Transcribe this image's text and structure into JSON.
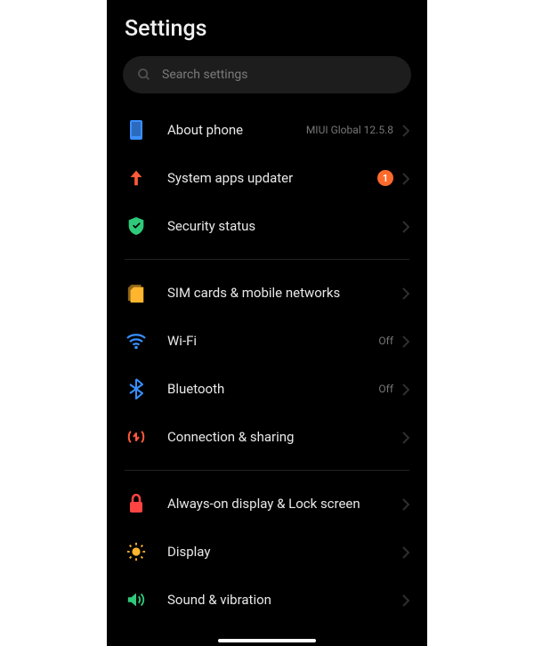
{
  "title": "Settings",
  "search": {
    "placeholder": "Search settings"
  },
  "groups": [
    {
      "items": [
        {
          "key": "about-phone",
          "label": "About phone",
          "status": "MIUI Global 12.5.8",
          "icon": "phone-icon"
        },
        {
          "key": "system-apps-updater",
          "label": "System apps updater",
          "badge": "1",
          "icon": "update-arrow-icon"
        },
        {
          "key": "security-status",
          "label": "Security status",
          "icon": "shield-check-icon"
        }
      ]
    },
    {
      "items": [
        {
          "key": "sim-cards",
          "label": "SIM cards & mobile networks",
          "icon": "sim-icon"
        },
        {
          "key": "wifi",
          "label": "Wi-Fi",
          "status": "Off",
          "icon": "wifi-icon"
        },
        {
          "key": "bluetooth",
          "label": "Bluetooth",
          "status": "Off",
          "icon": "bluetooth-icon"
        },
        {
          "key": "connection-sharing",
          "label": "Connection & sharing",
          "icon": "connection-icon"
        }
      ]
    },
    {
      "items": [
        {
          "key": "aod-lock",
          "label": "Always-on display & Lock screen",
          "icon": "lock-icon"
        },
        {
          "key": "display",
          "label": "Display",
          "icon": "sun-icon"
        },
        {
          "key": "sound-vibration",
          "label": "Sound & vibration",
          "icon": "speaker-icon"
        }
      ]
    }
  ],
  "colors": {
    "blue": "#3a8fff",
    "orangeRed": "#ff5a3c",
    "green": "#2fc97a",
    "amber": "#ffb62e",
    "red": "#ff4444"
  }
}
